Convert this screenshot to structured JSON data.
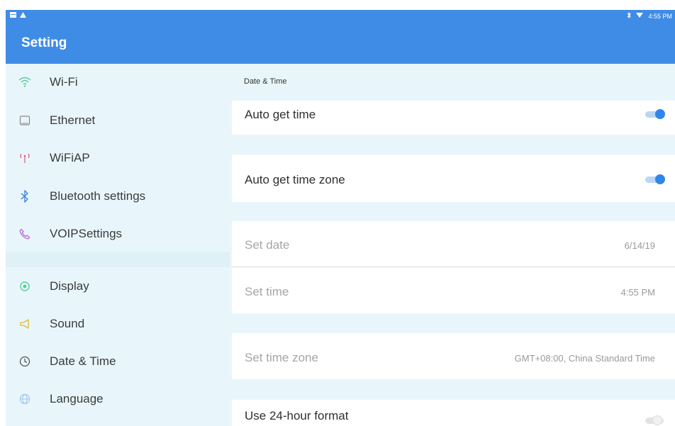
{
  "status_bar": {
    "time": "4:55 PM",
    "icons": [
      "notification-icon",
      "warning-icon",
      "bluetooth-icon",
      "wifi-icon"
    ]
  },
  "app_bar": {
    "title": "Setting"
  },
  "sidebar": {
    "items": [
      {
        "label": "Wi-Fi",
        "icon": "wifi-icon"
      },
      {
        "label": "Ethernet",
        "icon": "ethernet-icon"
      },
      {
        "label": "WiFiAP",
        "icon": "hotspot-icon"
      },
      {
        "label": "Bluetooth settings",
        "icon": "bluetooth-icon"
      },
      {
        "label": "VOIPSettings",
        "icon": "phone-icon"
      },
      {
        "label": "Display",
        "icon": "display-icon"
      },
      {
        "label": "Sound",
        "icon": "sound-icon"
      },
      {
        "label": "Date & Time",
        "icon": "clock-icon"
      },
      {
        "label": "Language",
        "icon": "globe-icon"
      }
    ]
  },
  "main": {
    "section_title": "Date & Time",
    "auto_time": {
      "label": "Auto get time",
      "on": true
    },
    "auto_zone": {
      "label": "Auto get time zone",
      "on": true
    },
    "set_date": {
      "label": "Set date",
      "value": "6/14/19"
    },
    "set_time": {
      "label": "Set time",
      "value": "4:55 PM"
    },
    "set_zone": {
      "label": "Set time zone",
      "value": "GMT+08:00, China Standard Time"
    },
    "format_24": {
      "label": "Use 24-hour format",
      "on": false
    }
  },
  "colors": {
    "accent": "#3f8ce6",
    "sidebar_bg": "#e8f6fb",
    "toggle_on": "#2f86e8"
  }
}
